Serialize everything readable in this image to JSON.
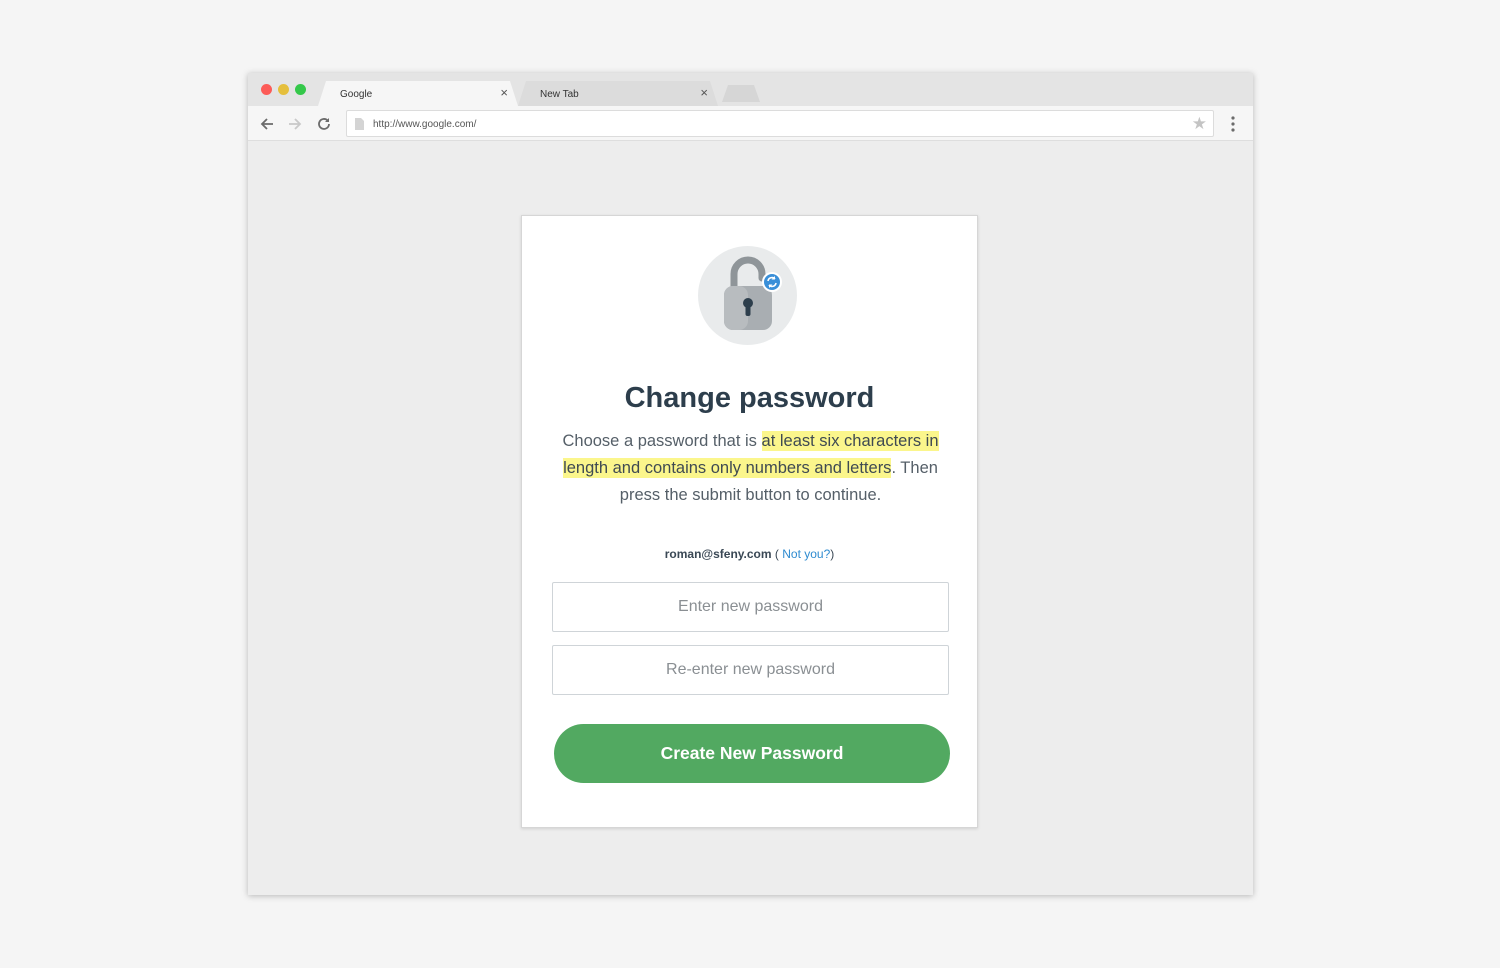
{
  "browser": {
    "tabs": [
      {
        "label": "Google",
        "close": "×"
      },
      {
        "label": "New Tab",
        "close": "×"
      }
    ],
    "url": "http://www.google.com/",
    "icons": {
      "back": "arrow-left-icon",
      "forward": "arrow-right-icon",
      "reload": "reload-icon",
      "page": "page-icon",
      "bookmark": "star-icon",
      "menu": "menu-dots-icon"
    }
  },
  "card": {
    "icon": "lock-refresh-icon",
    "title": "Change password",
    "description": {
      "before": "Choose a password that is ",
      "highlight": "at least six characters in length and contains only numbers and letters",
      "after": ". Then press the submit button to continue."
    },
    "user": {
      "email": "roman@sfeny.com",
      "open": " ( ",
      "not_you": "Not you?",
      "close": ")"
    },
    "fields": {
      "new_password_placeholder": "Enter new password",
      "confirm_password_placeholder": "Re-enter new password"
    },
    "submit_label": "Create New Password"
  },
  "colors": {
    "button": "#52a961",
    "highlight": "#fbf68c",
    "link": "#2e8bd0",
    "title": "#2d3e4c"
  }
}
